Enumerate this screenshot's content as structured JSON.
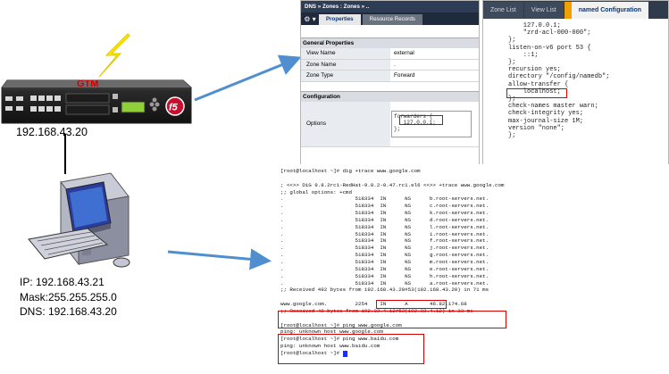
{
  "device": {
    "label": "GTM",
    "ip": "192.168.43.20",
    "logo": "f5"
  },
  "client": {
    "ip": "IP:  192.168.43.21",
    "mask": "Mask:255.255.255.0",
    "dns": "DNS: 192.168.43.20"
  },
  "config_panel": {
    "breadcrumb": "DNS  » Zones : Zones  » ..",
    "tabs": [
      {
        "label": "Properties"
      },
      {
        "label": "Resource Records"
      }
    ],
    "general_section": "General Properties",
    "rows": [
      {
        "label": "View Name",
        "value": "external"
      },
      {
        "label": "Zone Name",
        "value": "."
      },
      {
        "label": "Zone Type",
        "value": "Forward"
      }
    ],
    "config_section": "Configuration",
    "options_label": "Options",
    "options_text": "forwarders {\n   127.0.0.1;\n};"
  },
  "named_panel": {
    "tabs": [
      {
        "label": "Zone List"
      },
      {
        "label": "View List"
      },
      {
        "label": "named Configuration"
      }
    ],
    "code": "    127.0.0.1;\n    \"zrd-acl-000-000\";\n};\nlisten-on-v6 port 53 {\n    ::1;\n};\nrecursion yes;\ndirectory \"/config/namedb\";\nallow-transfer {\n    localhost;\n};\ncheck-names master warn;\ncheck-integrity yes;\nmax-journal-size 1M;\nversion \"none\";\n};"
  },
  "terminal": {
    "lines": [
      "[root@localhost ~]# dig +trace www.google.com",
      "",
      "; <<>> DiG 9.8.2rc1-RedHat-9.8.2-0.47.rc1.el6 <<>> +trace www.google.com",
      ";; global options: +cmd",
      ".                       518334  IN      NS      b.root-servers.net.",
      ".                       518334  IN      NS      c.root-servers.net.",
      ".                       518334  IN      NS      k.root-servers.net.",
      ".                       518334  IN      NS      d.root-servers.net.",
      ".                       518334  IN      NS      l.root-servers.net.",
      ".                       518334  IN      NS      i.root-servers.net.",
      ".                       518334  IN      NS      f.root-servers.net.",
      ".                       518334  IN      NS      j.root-servers.net.",
      ".                       518334  IN      NS      g.root-servers.net.",
      ".                       518334  IN      NS      m.root-servers.net.",
      ".                       518334  IN      NS      e.root-servers.net.",
      ".                       518334  IN      NS      h.root-servers.net.",
      ".                       518334  IN      NS      a.root-servers.net.",
      ";; Received 492 bytes from 192.168.43.20#53(192.168.43.20) in 71 ms",
      "",
      "www.google.com.         2254    IN      A       46.82.174.68",
      ";; Received 48 bytes from 192.33.4.12#53(192.33.4.12) in 33 ms",
      "",
      "[root@localhost ~]# ping www.google.com",
      "ping: unknown host www.google.com",
      "[root@localhost ~]# ping www.baidu.com",
      "ping: unknown host www.baidu.com",
      "[root@localhost ~]# "
    ]
  },
  "colors": {
    "arrow": "#4f8fd0",
    "highlight": "#dd0000",
    "device_label": "#d00000"
  }
}
